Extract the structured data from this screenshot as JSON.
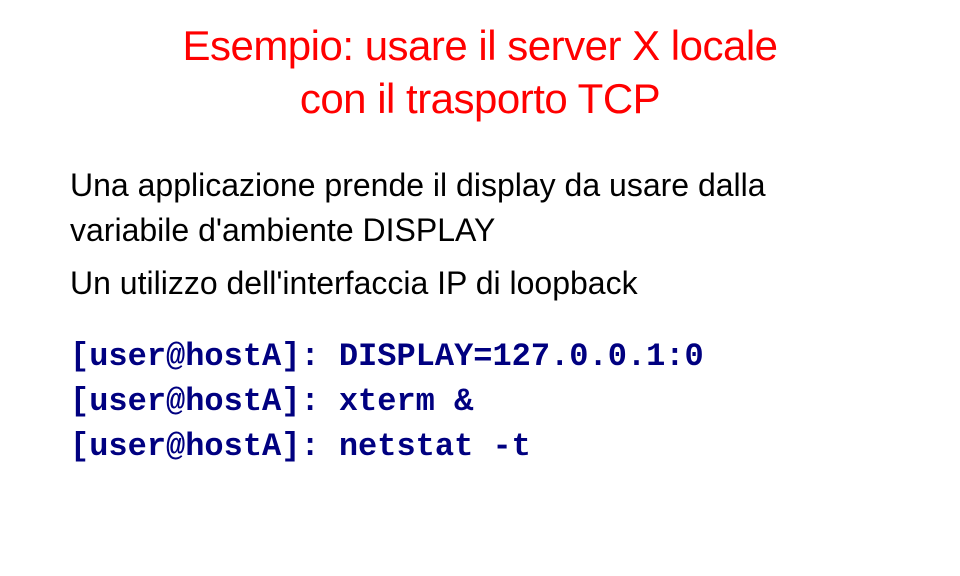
{
  "title": {
    "line1": "Esempio: usare il server X locale",
    "line2": "con il trasporto TCP"
  },
  "paragraphs": {
    "p1": "Una applicazione prende il display da usare dalla variabile d'ambiente DISPLAY",
    "p2": "Un utilizzo dell'interfaccia IP di loopback"
  },
  "code": {
    "line1": "[user@hostA]: DISPLAY=127.0.0.1:0",
    "line2": "[user@hostA]: xterm &",
    "line3": "[user@hostA]: netstat -t"
  }
}
